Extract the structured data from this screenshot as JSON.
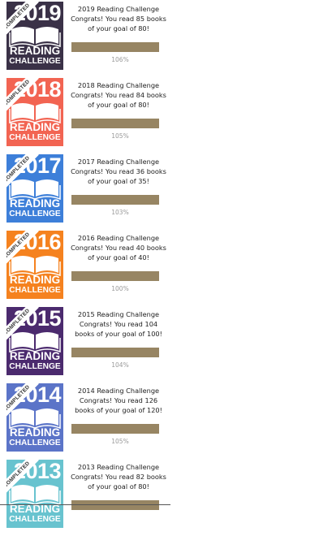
{
  "challenges": [
    {
      "year": "2019",
      "title": "2019 Reading Challenge",
      "message": "Congrats! You read 85 books of your goal of 80!",
      "percent_label": "106%",
      "progress": 1.0,
      "color": "#3a3147",
      "book_color": "#ffffff"
    },
    {
      "year": "2018",
      "title": "2018 Reading Challenge",
      "message": "Congrats! You read 84 books of your goal of 80!",
      "percent_label": "105%",
      "progress": 1.0,
      "color": "#f26452",
      "book_color": "#ffffff"
    },
    {
      "year": "2017",
      "title": "2017 Reading Challenge",
      "message": "Congrats! You read 36 books of your goal of 35!",
      "percent_label": "103%",
      "progress": 1.0,
      "color": "#3d7fd9",
      "book_color": "#ffffff"
    },
    {
      "year": "2016",
      "title": "2016 Reading Challenge",
      "message": "Congrats! You read 40 books of your goal of 40!",
      "percent_label": "100%",
      "progress": 1.0,
      "color": "#f5821f",
      "book_color": "#ffffff"
    },
    {
      "year": "2015",
      "title": "2015 Reading Challenge",
      "message": "Congrats! You read 104 books of your goal of 100!",
      "percent_label": "104%",
      "progress": 1.0,
      "color": "#4b2a6e",
      "book_color": "#ffffff"
    },
    {
      "year": "2014",
      "title": "2014 Reading Challenge",
      "message": "Congrats! You read 126 books of your goal of 120!",
      "percent_label": "105%",
      "progress": 1.0,
      "color": "#5b74c8",
      "book_color": "#ffffff"
    },
    {
      "year": "2013",
      "title": "2013 Reading Challenge",
      "message": "Congrats! You read 82 books of your goal of 80!",
      "percent_label": "",
      "progress": 1.0,
      "color": "#68c3cf",
      "book_color": "#ffffff"
    }
  ],
  "badge_text": {
    "ribbon": "COMPLETED",
    "reading": "READING",
    "challenge": "CHALLENGE"
  }
}
